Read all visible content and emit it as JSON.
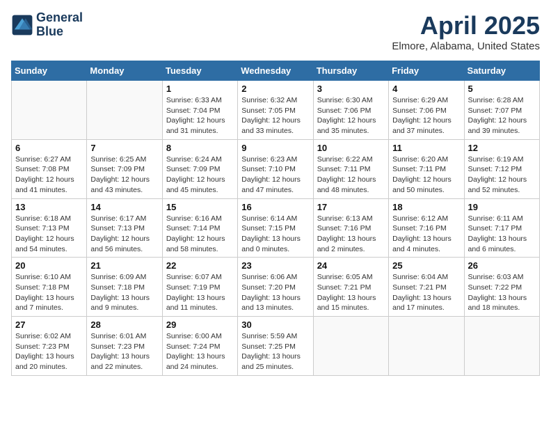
{
  "logo": {
    "line1": "General",
    "line2": "Blue"
  },
  "title": "April 2025",
  "location": "Elmore, Alabama, United States",
  "weekdays": [
    "Sunday",
    "Monday",
    "Tuesday",
    "Wednesday",
    "Thursday",
    "Friday",
    "Saturday"
  ],
  "weeks": [
    [
      {
        "day": "",
        "info": ""
      },
      {
        "day": "",
        "info": ""
      },
      {
        "day": "1",
        "info": "Sunrise: 6:33 AM\nSunset: 7:04 PM\nDaylight: 12 hours and 31 minutes."
      },
      {
        "day": "2",
        "info": "Sunrise: 6:32 AM\nSunset: 7:05 PM\nDaylight: 12 hours and 33 minutes."
      },
      {
        "day": "3",
        "info": "Sunrise: 6:30 AM\nSunset: 7:06 PM\nDaylight: 12 hours and 35 minutes."
      },
      {
        "day": "4",
        "info": "Sunrise: 6:29 AM\nSunset: 7:06 PM\nDaylight: 12 hours and 37 minutes."
      },
      {
        "day": "5",
        "info": "Sunrise: 6:28 AM\nSunset: 7:07 PM\nDaylight: 12 hours and 39 minutes."
      }
    ],
    [
      {
        "day": "6",
        "info": "Sunrise: 6:27 AM\nSunset: 7:08 PM\nDaylight: 12 hours and 41 minutes."
      },
      {
        "day": "7",
        "info": "Sunrise: 6:25 AM\nSunset: 7:09 PM\nDaylight: 12 hours and 43 minutes."
      },
      {
        "day": "8",
        "info": "Sunrise: 6:24 AM\nSunset: 7:09 PM\nDaylight: 12 hours and 45 minutes."
      },
      {
        "day": "9",
        "info": "Sunrise: 6:23 AM\nSunset: 7:10 PM\nDaylight: 12 hours and 47 minutes."
      },
      {
        "day": "10",
        "info": "Sunrise: 6:22 AM\nSunset: 7:11 PM\nDaylight: 12 hours and 48 minutes."
      },
      {
        "day": "11",
        "info": "Sunrise: 6:20 AM\nSunset: 7:11 PM\nDaylight: 12 hours and 50 minutes."
      },
      {
        "day": "12",
        "info": "Sunrise: 6:19 AM\nSunset: 7:12 PM\nDaylight: 12 hours and 52 minutes."
      }
    ],
    [
      {
        "day": "13",
        "info": "Sunrise: 6:18 AM\nSunset: 7:13 PM\nDaylight: 12 hours and 54 minutes."
      },
      {
        "day": "14",
        "info": "Sunrise: 6:17 AM\nSunset: 7:13 PM\nDaylight: 12 hours and 56 minutes."
      },
      {
        "day": "15",
        "info": "Sunrise: 6:16 AM\nSunset: 7:14 PM\nDaylight: 12 hours and 58 minutes."
      },
      {
        "day": "16",
        "info": "Sunrise: 6:14 AM\nSunset: 7:15 PM\nDaylight: 13 hours and 0 minutes."
      },
      {
        "day": "17",
        "info": "Sunrise: 6:13 AM\nSunset: 7:16 PM\nDaylight: 13 hours and 2 minutes."
      },
      {
        "day": "18",
        "info": "Sunrise: 6:12 AM\nSunset: 7:16 PM\nDaylight: 13 hours and 4 minutes."
      },
      {
        "day": "19",
        "info": "Sunrise: 6:11 AM\nSunset: 7:17 PM\nDaylight: 13 hours and 6 minutes."
      }
    ],
    [
      {
        "day": "20",
        "info": "Sunrise: 6:10 AM\nSunset: 7:18 PM\nDaylight: 13 hours and 7 minutes."
      },
      {
        "day": "21",
        "info": "Sunrise: 6:09 AM\nSunset: 7:18 PM\nDaylight: 13 hours and 9 minutes."
      },
      {
        "day": "22",
        "info": "Sunrise: 6:07 AM\nSunset: 7:19 PM\nDaylight: 13 hours and 11 minutes."
      },
      {
        "day": "23",
        "info": "Sunrise: 6:06 AM\nSunset: 7:20 PM\nDaylight: 13 hours and 13 minutes."
      },
      {
        "day": "24",
        "info": "Sunrise: 6:05 AM\nSunset: 7:21 PM\nDaylight: 13 hours and 15 minutes."
      },
      {
        "day": "25",
        "info": "Sunrise: 6:04 AM\nSunset: 7:21 PM\nDaylight: 13 hours and 17 minutes."
      },
      {
        "day": "26",
        "info": "Sunrise: 6:03 AM\nSunset: 7:22 PM\nDaylight: 13 hours and 18 minutes."
      }
    ],
    [
      {
        "day": "27",
        "info": "Sunrise: 6:02 AM\nSunset: 7:23 PM\nDaylight: 13 hours and 20 minutes."
      },
      {
        "day": "28",
        "info": "Sunrise: 6:01 AM\nSunset: 7:23 PM\nDaylight: 13 hours and 22 minutes."
      },
      {
        "day": "29",
        "info": "Sunrise: 6:00 AM\nSunset: 7:24 PM\nDaylight: 13 hours and 24 minutes."
      },
      {
        "day": "30",
        "info": "Sunrise: 5:59 AM\nSunset: 7:25 PM\nDaylight: 13 hours and 25 minutes."
      },
      {
        "day": "",
        "info": ""
      },
      {
        "day": "",
        "info": ""
      },
      {
        "day": "",
        "info": ""
      }
    ]
  ]
}
